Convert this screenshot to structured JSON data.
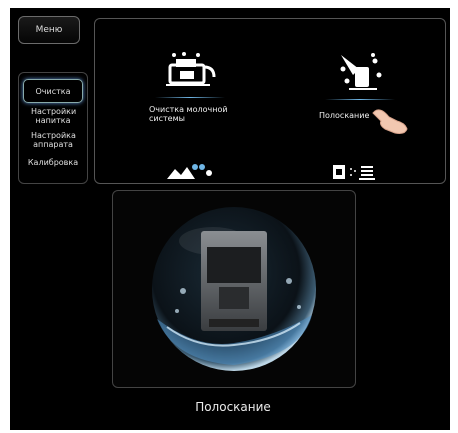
{
  "header": {
    "menu_label": "Меню"
  },
  "sidebar": {
    "items": [
      {
        "label": "Очистка",
        "active": true
      },
      {
        "label": "Настройки напитка"
      },
      {
        "label": "Настройка аппарата"
      },
      {
        "label": "Калибровка"
      }
    ]
  },
  "tiles": [
    {
      "label": "Очистка молочной системы",
      "icon": "milk-system-cleaning-icon"
    },
    {
      "label": "Полоскание",
      "icon": "rinse-icon",
      "selected": true
    },
    {
      "label": "",
      "icon": "descaling-icon"
    },
    {
      "label": "",
      "icon": "filter-icon"
    }
  ],
  "preview": {
    "caption": "Полоскание",
    "icon": "coffee-machine-in-water-bubble-image"
  },
  "colors": {
    "background": "#000000",
    "accent": "#6fb6e6"
  }
}
